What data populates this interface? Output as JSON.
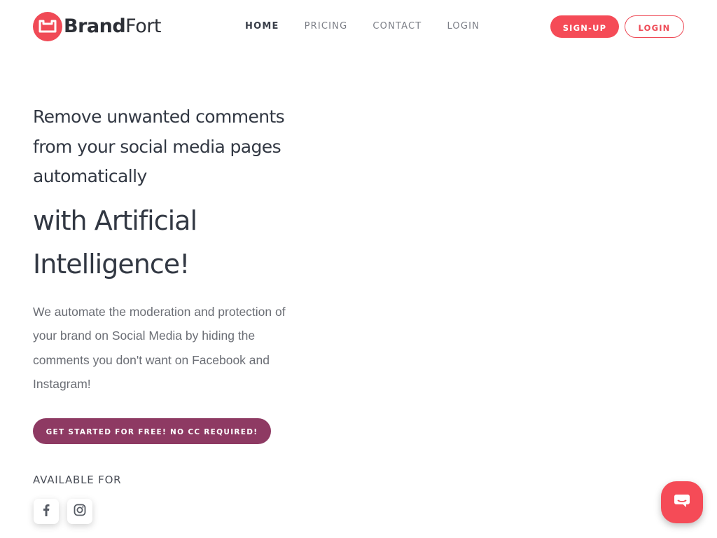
{
  "brand": {
    "name_bold": "Brand",
    "name_light": "Fort",
    "logo_color": "#f04a56"
  },
  "nav": {
    "items": [
      {
        "label": "HOME",
        "active": true
      },
      {
        "label": "PRICING",
        "active": false
      },
      {
        "label": "CONTACT",
        "active": false
      },
      {
        "label": "LOGIN",
        "active": false
      }
    ]
  },
  "header_buttons": {
    "signup_label": "SIGN-UP",
    "login_label": "LOGIN"
  },
  "hero": {
    "subtitle": "Remove unwanted comments from your social media pages automatically",
    "title": "with Artificial Intelligence!",
    "description": "We automate the moderation and protection of your brand on Social Media by hiding the comments you don't want on Facebook and Instagram!",
    "cta_label": "GET STARTED FOR FREE! NO CC REQUIRED!"
  },
  "available": {
    "label": "AVAILABLE FOR",
    "platforms": [
      {
        "icon": "facebook-icon"
      },
      {
        "icon": "instagram-icon"
      }
    ]
  },
  "chat_widget": {
    "icon": "chat-bubble-icon"
  },
  "colors": {
    "accent": "#f54b57",
    "cta": "#8e3a63",
    "text_dark": "#323843",
    "text_muted": "#6b6e75"
  }
}
